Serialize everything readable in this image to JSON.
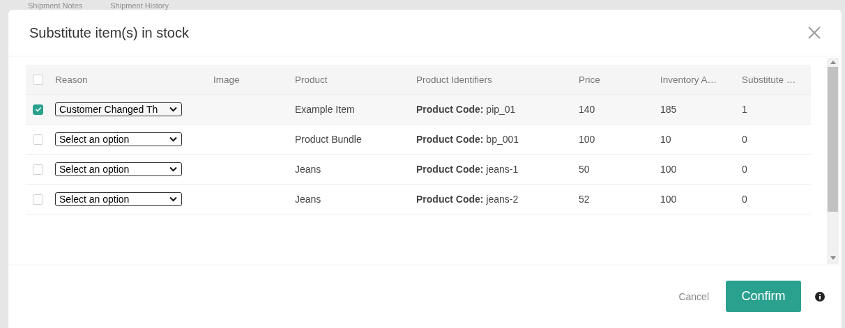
{
  "background_tabs": [
    "Shipment Notes",
    "Shipment History"
  ],
  "dialog": {
    "title": "Substitute item(s) in stock"
  },
  "table": {
    "select_all_checked": false,
    "columns": [
      "Reason",
      "Image",
      "Product",
      "Product Identifiers",
      "Price",
      "Inventory A…",
      "Substitute …"
    ],
    "rows": [
      {
        "checked": true,
        "reason": "Customer Changed Th",
        "product": "Example Item",
        "identifier_label": "Product Code:",
        "identifier": "pip_01",
        "price": "140",
        "inventory": "185",
        "substitute": "1"
      },
      {
        "checked": false,
        "reason": "Select an option",
        "product": "Product Bundle",
        "identifier_label": "Product Code:",
        "identifier": "bp_001",
        "price": "100",
        "inventory": "10",
        "substitute": "0"
      },
      {
        "checked": false,
        "reason": "Select an option",
        "product": "Jeans",
        "identifier_label": "Product Code:",
        "identifier": "jeans-1",
        "price": "50",
        "inventory": "100",
        "substitute": "0"
      },
      {
        "checked": false,
        "reason": "Select an option",
        "product": "Jeans",
        "identifier_label": "Product Code:",
        "identifier": "jeans-2",
        "price": "52",
        "inventory": "100",
        "substitute": "0"
      }
    ]
  },
  "footer": {
    "cancel": "Cancel",
    "confirm": "Confirm"
  }
}
